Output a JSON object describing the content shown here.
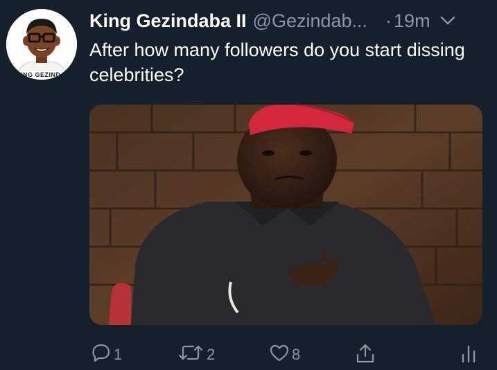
{
  "user": {
    "display_name": "King Gezindaba II",
    "handle": "@Gezindab...",
    "time_separator": "·",
    "time": "19m",
    "avatar_caption": "KING GEZINDA"
  },
  "tweet": {
    "text": "After how many followers do you start dissing celebrities?"
  },
  "actions": {
    "reply_count": "1",
    "retweet_count": "2",
    "like_count": "8"
  },
  "colors": {
    "background": "#15202b",
    "primary_text": "#ffffff",
    "secondary_text": "#8899a6"
  },
  "icons": [
    "caret-down-icon",
    "reply-icon",
    "retweet-icon",
    "like-icon",
    "share-icon",
    "analytics-icon"
  ]
}
